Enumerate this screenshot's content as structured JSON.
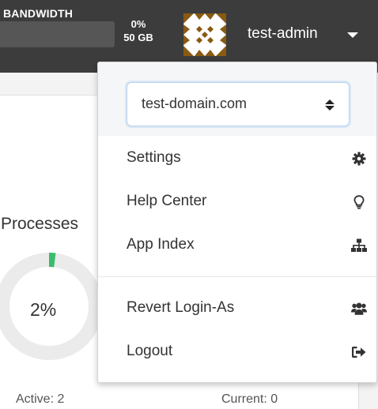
{
  "header": {
    "bandwidth_label": "BANDWIDTH",
    "bandwidth_percent": "0%",
    "bandwidth_total": "50 GB",
    "username": "test-admin"
  },
  "processes": {
    "title": "Processes",
    "percent_label": "2%",
    "percent_value": 2,
    "active_label": "Active: 2",
    "current_label": "Current: 0"
  },
  "dropdown": {
    "domain_selected": "test-domain.com",
    "items": [
      {
        "label": "Settings",
        "icon": "gear-icon"
      },
      {
        "label": "Help Center",
        "icon": "lightbulb-icon"
      },
      {
        "label": "App Index",
        "icon": "sitemap-icon"
      },
      {
        "label": "Revert Login-As",
        "icon": "users-icon"
      },
      {
        "label": "Logout",
        "icon": "sign-out-icon"
      }
    ]
  },
  "colors": {
    "topbar": "#3c3c3c",
    "progress_accent": "#3dba6f",
    "avatar_pattern": "#8a5a12"
  }
}
